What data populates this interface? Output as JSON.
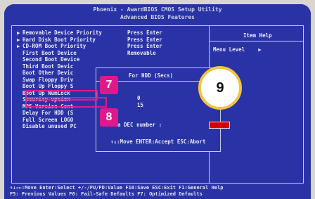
{
  "bios": {
    "title_line1": "Phoenix - AwardBIOS CMOS Setup Utility",
    "title_line2": "Advanced BIOS Features",
    "menu_items": [
      {
        "arrow": "▶",
        "label": "Removable Device Priority",
        "value": "Press Enter"
      },
      {
        "arrow": "▶",
        "label": "Hard Disk Boot Priority",
        "value": "Press Enter"
      },
      {
        "arrow": "▶",
        "label": "CD-ROM Boot Priority",
        "value": "Press Enter"
      },
      {
        "arrow": "",
        "label": "First Boot Device",
        "value": "Removable"
      },
      {
        "arrow": "",
        "label": "Second Boot Device",
        "value": ""
      },
      {
        "arrow": "",
        "label": "Third Boot Devic",
        "value": ""
      },
      {
        "arrow": "",
        "label": "Boot Other Devic",
        "value": ""
      },
      {
        "arrow": "",
        "label": "Swap Floppy Driv",
        "value": ""
      },
      {
        "arrow": "",
        "label": "Boot Up Floppy S",
        "value": ""
      },
      {
        "arrow": "",
        "label": "Boot Up NumLock",
        "value": ""
      },
      {
        "arrow": "",
        "label": "Security Option",
        "value": ""
      },
      {
        "arrow": "",
        "label": "MPS Version Cont",
        "value": ""
      },
      {
        "arrow": "",
        "label": "Delay For HDD (S",
        "value": ""
      },
      {
        "arrow": "",
        "label": "Full Screen LOGO",
        "value": ""
      },
      {
        "arrow": "",
        "label": "Disable unused PC",
        "value": ""
      }
    ],
    "help": {
      "title": "Item Help",
      "menu_level_label": "Menu Level",
      "menu_level_arrow": "▶"
    },
    "dialog": {
      "title": "For HDD (Secs)",
      "min_line": "0",
      "max_line": "15",
      "prompt": "a DEC number :",
      "footer": "↑↓:Move ENTER:Accept ESC:Abort"
    },
    "bottom": {
      "line1": "↑↓→←:Move  Enter:Select  +/-/PU/PD:Value  F10:Save  ESC:Exit  F1:General Help",
      "line2": "F5: Previous Values    F6: Fail-Safe Defaults    F7: Optimized Defaults"
    }
  },
  "annotations": {
    "badge_7": "7",
    "badge_8": "8",
    "circle_9": "9",
    "accent_color": "#e0198a",
    "circle_border_color": "#f1c542"
  }
}
